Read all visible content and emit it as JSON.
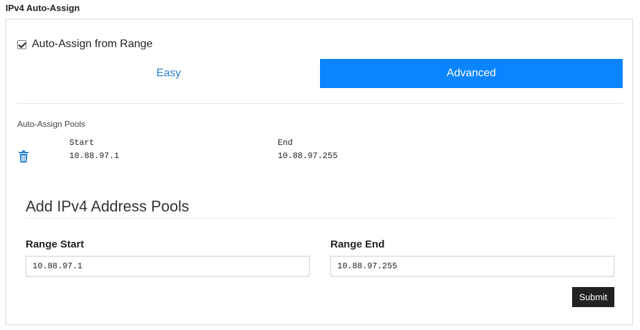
{
  "section": {
    "title": "IPv4 Auto-Assign"
  },
  "auto_assign": {
    "label": "Auto-Assign from Range",
    "checked": true
  },
  "mode_tabs": [
    {
      "label": "Easy",
      "active": false
    },
    {
      "label": "Advanced",
      "active": true
    }
  ],
  "pools": {
    "label": "Auto-Assign Pools",
    "headers": {
      "start": "Start",
      "end": "End"
    },
    "rows": [
      {
        "start": "10.88.97.1",
        "end": "10.88.97.255",
        "delete_icon": "trash-icon"
      }
    ]
  },
  "add_pools": {
    "title": "Add IPv4 Address Pools",
    "range_start_label": "Range Start",
    "range_start_value": "10.88.97.1",
    "range_end_label": "Range End",
    "range_end_value": "10.88.97.255",
    "submit_label": "Submit"
  },
  "colors": {
    "accent": "#0a84ff",
    "link": "#2a7fd4",
    "submit_bg": "#222222"
  }
}
